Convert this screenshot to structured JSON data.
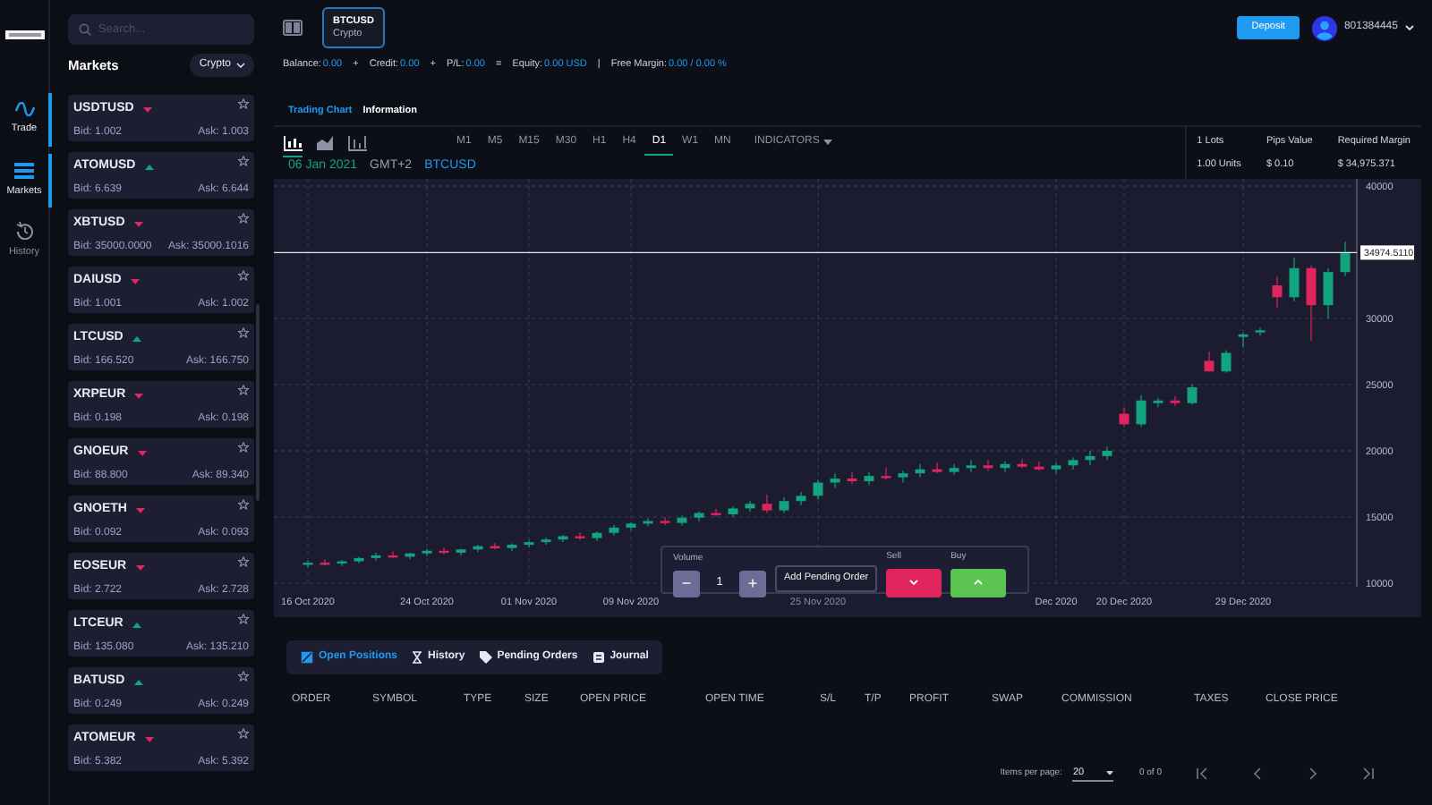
{
  "nav_rail": [
    {
      "label": "Trade",
      "kind": "wave",
      "selected": true
    },
    {
      "label": "Markets",
      "kind": "list",
      "selected": true
    },
    {
      "label": "History",
      "kind": "history",
      "selected": false
    }
  ],
  "sidebar": {
    "search": {
      "placeholder": "Search..."
    },
    "title": "Markets",
    "filter": "Crypto",
    "markets": [
      {
        "symbol": "USDTUSD",
        "rising": false,
        "bid": "Bid: 1.002",
        "ask": "Ask: 1.003"
      },
      {
        "symbol": "ATOMUSD",
        "rising": true,
        "bid": "Bid: 6.639",
        "ask": "Ask: 6.644"
      },
      {
        "symbol": "XBTUSD",
        "rising": false,
        "bid": "Bid: 35000.0000",
        "ask": "Ask: 35000.1016"
      },
      {
        "symbol": "DAIUSD",
        "rising": false,
        "bid": "Bid: 1.001",
        "ask": "Ask: 1.002"
      },
      {
        "symbol": "LTCUSD",
        "rising": true,
        "bid": "Bid: 166.520",
        "ask": "Ask: 166.750"
      },
      {
        "symbol": "XRPEUR",
        "rising": false,
        "bid": "Bid: 0.198",
        "ask": "Ask: 0.198"
      },
      {
        "symbol": "GNOEUR",
        "rising": false,
        "bid": "Bid: 88.800",
        "ask": "Ask: 89.340"
      },
      {
        "symbol": "GNOETH",
        "rising": false,
        "bid": "Bid: 0.092",
        "ask": "Ask: 0.093"
      },
      {
        "symbol": "EOSEUR",
        "rising": false,
        "bid": "Bid: 2.722",
        "ask": "Ask: 2.728"
      },
      {
        "symbol": "LTCEUR",
        "rising": true,
        "bid": "Bid: 135.080",
        "ask": "Ask: 135.210"
      },
      {
        "symbol": "BATUSD",
        "rising": true,
        "bid": "Bid: 0.249",
        "ask": "Ask: 0.249"
      },
      {
        "symbol": "ATOMEUR",
        "rising": false,
        "bid": "Bid: 5.382",
        "ask": "Ask: 5.392"
      }
    ]
  },
  "header": {
    "symbol_tab": {
      "symbol": "BTCUSD",
      "category": "Crypto"
    },
    "deposit": "Deposit",
    "account": "801384445"
  },
  "account_summary": [
    {
      "label": "Balance:",
      "value": "0.00",
      "after": "+"
    },
    {
      "label": "Credit:",
      "value": "0.00",
      "after": "+"
    },
    {
      "label": "P/L:",
      "value": "0.00",
      "after": "="
    },
    {
      "label": "Equity:",
      "value": "0.00 USD",
      "after": "|"
    },
    {
      "label": "Free Margin:",
      "value": "0.00 / 0.00 %"
    }
  ],
  "chart_tabs": [
    {
      "label": "Trading Chart",
      "selected": true
    },
    {
      "label": "Information",
      "selected": false
    }
  ],
  "chart_types": [
    {
      "kind": "candles",
      "selected": true
    },
    {
      "kind": "area",
      "selected": false
    },
    {
      "kind": "bars",
      "selected": false
    }
  ],
  "timeframes": [
    {
      "label": "M1",
      "selected": false
    },
    {
      "label": "M5",
      "selected": false
    },
    {
      "label": "M15",
      "selected": false
    },
    {
      "label": "M30",
      "selected": false
    },
    {
      "label": "H1",
      "selected": false
    },
    {
      "label": "H4",
      "selected": false
    },
    {
      "label": "D1",
      "selected": true
    },
    {
      "label": "W1",
      "selected": false
    },
    {
      "label": "MN",
      "selected": false
    }
  ],
  "indicators": "INDICATORS",
  "contract_info": [
    {
      "label": "1 Lots",
      "value": "1.00 Units"
    },
    {
      "label": "Pips Value",
      "value": "$ 0.10"
    },
    {
      "label": "Required Margin",
      "value": "$ 34,975.371"
    }
  ],
  "chart_header": {
    "date": "06 Jan 2021",
    "timezone": "GMT+2",
    "symbol": "BTCUSD"
  },
  "chart": {
    "chart_data": {
      "type": "candlestick",
      "grid": true,
      "ref_lines": [
        {
          "axis": "y",
          "value": 34974.511,
          "label": "34974.5110"
        }
      ],
      "categories": [
        "16 Oct 2020",
        null,
        null,
        null,
        null,
        null,
        null,
        "24 Oct 2020",
        null,
        null,
        null,
        null,
        null,
        "01 Nov 2020",
        null,
        null,
        null,
        null,
        null,
        "09 Nov 2020",
        null,
        null,
        null,
        null,
        null,
        null,
        null,
        null,
        null,
        null,
        "25 Nov 2020",
        null,
        null,
        null,
        null,
        null,
        null,
        null,
        null,
        null,
        null,
        null,
        null,
        null,
        "Dec 2020",
        null,
        null,
        null,
        "20 Dec 2020",
        null,
        null,
        null,
        null,
        null,
        null,
        "29 Dec 2020",
        null,
        null,
        null,
        null,
        null,
        null
      ],
      "ohlc": [
        [
          11400,
          11700,
          11200,
          11550
        ],
        [
          11550,
          11800,
          11350,
          11500
        ],
        [
          11500,
          11750,
          11300,
          11650
        ],
        [
          11650,
          12000,
          11500,
          11900
        ],
        [
          11900,
          12300,
          11700,
          12100
        ],
        [
          12100,
          12400,
          11900,
          12000
        ],
        [
          12000,
          12300,
          11800,
          12250
        ],
        [
          12250,
          12600,
          12050,
          12450
        ],
        [
          12450,
          12700,
          12200,
          12300
        ],
        [
          12300,
          12600,
          12100,
          12550
        ],
        [
          12550,
          12900,
          12350,
          12800
        ],
        [
          12800,
          13050,
          12550,
          12650
        ],
        [
          12650,
          13000,
          12450,
          12900
        ],
        [
          12900,
          13250,
          12700,
          13100
        ],
        [
          13100,
          13450,
          12900,
          13300
        ],
        [
          13300,
          13650,
          13100,
          13550
        ],
        [
          13550,
          13850,
          13300,
          13400
        ],
        [
          13400,
          13900,
          13200,
          13800
        ],
        [
          13800,
          14400,
          13600,
          14200
        ],
        [
          14200,
          14600,
          14000,
          14500
        ],
        [
          14500,
          14900,
          14300,
          14700
        ],
        [
          14700,
          15000,
          14400,
          14550
        ],
        [
          14550,
          15100,
          14350,
          14950
        ],
        [
          14950,
          15400,
          14700,
          15300
        ],
        [
          15300,
          15600,
          15050,
          15200
        ],
        [
          15200,
          15800,
          15000,
          15650
        ],
        [
          15650,
          16200,
          15400,
          16000
        ],
        [
          16000,
          16700,
          15300,
          15500
        ],
        [
          15500,
          16500,
          15300,
          16200
        ],
        [
          16200,
          16900,
          15900,
          16600
        ],
        [
          16600,
          17800,
          16300,
          17600
        ],
        [
          17600,
          18300,
          17200,
          17900
        ],
        [
          17900,
          18400,
          17500,
          17700
        ],
        [
          17700,
          18400,
          17400,
          18100
        ],
        [
          18100,
          18700,
          17800,
          18000
        ],
        [
          18000,
          18500,
          17600,
          18300
        ],
        [
          18300,
          19000,
          18000,
          18600
        ],
        [
          18600,
          19100,
          18300,
          18400
        ],
        [
          18400,
          19000,
          18200,
          18700
        ],
        [
          18700,
          19300,
          18400,
          18900
        ],
        [
          18900,
          19300,
          18500,
          18700
        ],
        [
          18700,
          19200,
          18400,
          19000
        ],
        [
          19000,
          19400,
          18700,
          18800
        ],
        [
          18800,
          19200,
          18500,
          18600
        ],
        [
          18600,
          19100,
          18300,
          18900
        ],
        [
          18900,
          19500,
          18600,
          19300
        ],
        [
          19300,
          20000,
          18900,
          19600
        ],
        [
          19600,
          20300,
          19300,
          20000
        ],
        [
          22800,
          23300,
          21800,
          22000
        ],
        [
          22000,
          24200,
          21800,
          23800
        ],
        [
          23600,
          24000,
          23300,
          23800
        ],
        [
          23800,
          24100,
          23400,
          23600
        ],
        [
          23600,
          25000,
          23500,
          24800
        ],
        [
          26800,
          27500,
          26000,
          26000
        ],
        [
          26000,
          27600,
          25900,
          27400
        ],
        [
          28600,
          28900,
          27800,
          28800
        ],
        [
          29000,
          29300,
          28700,
          29100
        ],
        [
          32500,
          33200,
          30800,
          31600
        ],
        [
          31600,
          34600,
          31300,
          33800
        ],
        [
          33800,
          34000,
          28300,
          31000
        ],
        [
          31000,
          33800,
          30000,
          33500
        ],
        [
          33500,
          35800,
          33200,
          34974
        ]
      ],
      "ylim": [
        10000,
        40000
      ],
      "yticks": [
        10000,
        15000,
        20000,
        25000,
        30000,
        40000
      ]
    }
  },
  "order_ticket": {
    "volume_label": "Volume",
    "minus": "−",
    "volume": "1",
    "plus": "+",
    "pending": "Add Pending Order",
    "sell_label": "Sell",
    "buy_label": "Buy"
  },
  "positions_tabs": [
    {
      "label": "Open Positions",
      "kind": "positions",
      "selected": true
    },
    {
      "label": "History",
      "kind": "history",
      "selected": false
    },
    {
      "label": "Pending Orders",
      "kind": "tag",
      "selected": false
    },
    {
      "label": "Journal",
      "kind": "journal",
      "selected": false
    }
  ],
  "table": {
    "columns": [
      "ORDER",
      "SYMBOL",
      "TYPE",
      "SIZE",
      "OPEN PRICE",
      "OPEN TIME",
      "S/L",
      "T/P",
      "PROFIT",
      "SWAP",
      "COMMISSION",
      "TAXES",
      "CLOSE PRICE"
    ]
  },
  "pagination": {
    "label": "Items per page:",
    "page_size": "20",
    "range": "0 of 0"
  }
}
